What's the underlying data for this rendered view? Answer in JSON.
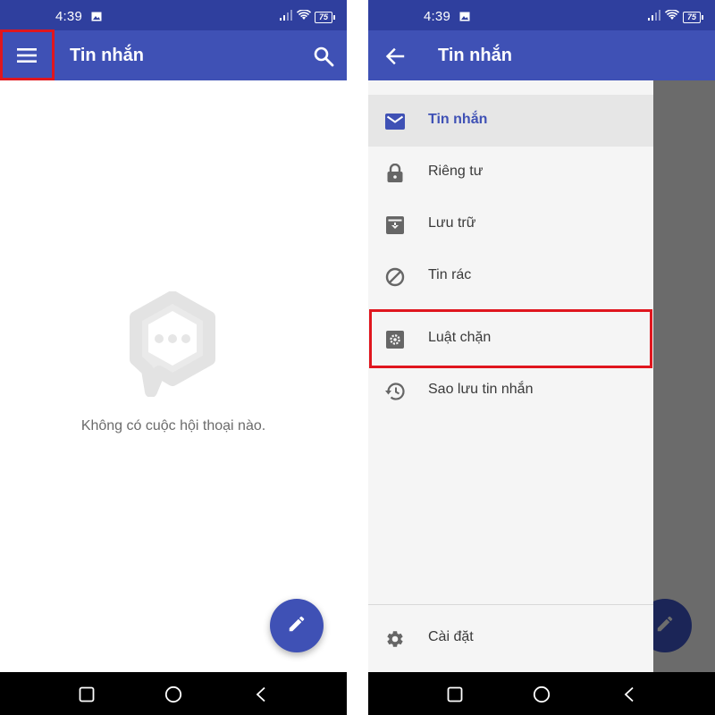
{
  "left_screen": {
    "status": {
      "time": "4:39",
      "battery": "75"
    },
    "appbar": {
      "title": "Tin nhắn",
      "menu_icon": "hamburger-menu-icon",
      "search_icon": "search-icon"
    },
    "empty_state": {
      "icon": "chat-bubble-dots-icon",
      "message": "Không có cuộc hội thoại nào."
    },
    "fab": {
      "icon": "pencil-icon"
    },
    "highlight_color": "#e0161e"
  },
  "right_screen": {
    "status": {
      "time": "4:39",
      "battery": "75"
    },
    "appbar": {
      "title": "Tin nhắn",
      "back_icon": "arrow-back-icon"
    },
    "drawer": {
      "items": [
        {
          "label": "Tin nhắn",
          "icon": "mail-icon",
          "active": true
        },
        {
          "label": "Riêng tư",
          "icon": "lock-icon",
          "active": false
        },
        {
          "label": "Lưu trữ",
          "icon": "archive-icon",
          "active": false
        },
        {
          "label": "Tin rác",
          "icon": "block-icon",
          "active": false
        },
        {
          "label": "Luật chặn",
          "icon": "gear-box-icon",
          "active": false,
          "highlighted": true
        },
        {
          "label": "Sao lưu tin nhắn",
          "icon": "restore-icon",
          "active": false
        }
      ],
      "footer": {
        "label": "Cài đặt",
        "icon": "settings-icon"
      }
    },
    "fab": {
      "icon": "pencil-icon"
    }
  },
  "colors": {
    "status_bar": "#2f3f9e",
    "app_bar": "#3f51b5",
    "accent": "#3f51b5",
    "drawer_background": "#f5f5f5",
    "scrim": "#6b6b6b"
  }
}
